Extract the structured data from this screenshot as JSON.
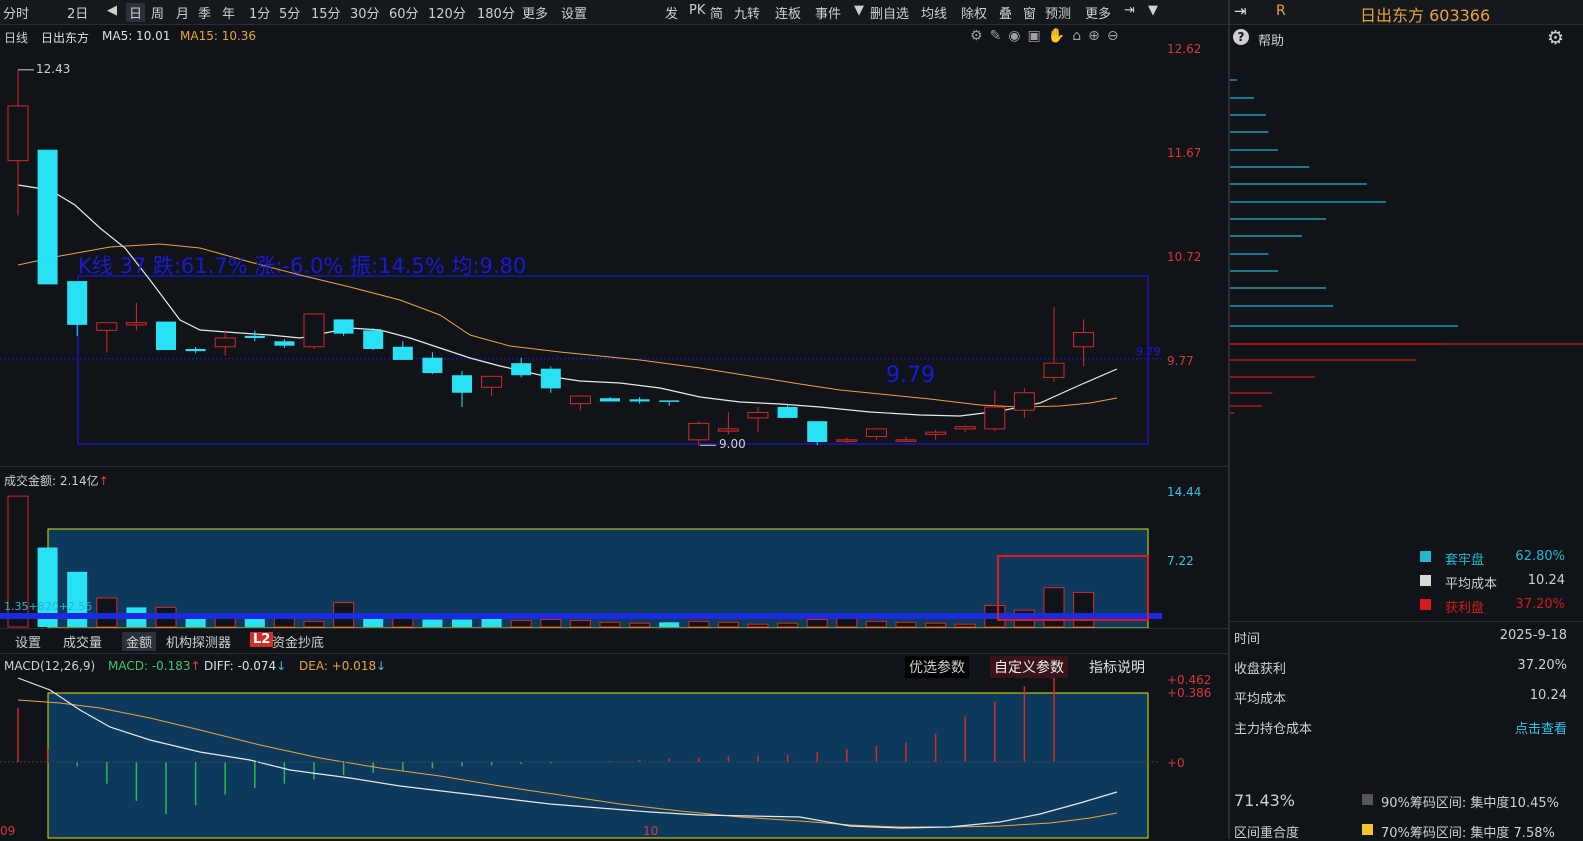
{
  "toolbar": {
    "left_items": [
      "分时",
      "2日",
      "日",
      "周",
      "月",
      "季",
      "年",
      "1分",
      "5分",
      "15分",
      "30分",
      "60分",
      "120分",
      "180分",
      "更多",
      "设置"
    ],
    "right_items": [
      "发",
      "PK",
      "简",
      "九转",
      "连板",
      "事件",
      "删自选",
      "均线",
      "除权",
      "叠",
      "窗",
      "预测",
      "更多"
    ]
  },
  "kline": {
    "period": "日线",
    "name": "日出东方",
    "ma5_label": "MA5: 10.01",
    "ma15_label": "MA15: 10.36",
    "summary": "K线 37 跌:61.7% 涨:-6.0% 振:14.5% 均:9.80",
    "high_label": "12.43",
    "low_label": "9.00",
    "avg_label": "9.79",
    "avg_tag": "9.79",
    "y_ticks": [
      "12.62",
      "11.67",
      "10.72",
      "9.77"
    ]
  },
  "volume": {
    "title": "成交金额: 2.14亿",
    "y_ticks": [
      "14.44",
      "7.22"
    ],
    "overlay_text": "1.35+820+2.55"
  },
  "tabs": [
    "设置",
    "成交量",
    "金额",
    "机构探测器",
    "L2",
    "资金抄底"
  ],
  "macd": {
    "params": "MACD(12,26,9)",
    "macd_label": "MACD: -0.183",
    "diff_label": "DIFF: -0.074",
    "dea_label": "DEA: +0.018",
    "buttons": [
      "优选参数",
      "自定义参数",
      "指标说明"
    ],
    "y_ticks": [
      "+0.462",
      "+0.386",
      "+0"
    ]
  },
  "x_labels": [
    "09",
    "10"
  ],
  "right_panel": {
    "r_label": "R",
    "stock": "日出东方 603366",
    "help": "帮助",
    "legend": [
      {
        "label": "套牢盘",
        "value": "62.80%",
        "color": "#23b7cc"
      },
      {
        "label": "平均成本",
        "value": "10.24",
        "color": "#d8d8d8"
      },
      {
        "label": "获利盘",
        "value": "37.20%",
        "color": "#d41a1a"
      }
    ],
    "stats": [
      {
        "label": "时间",
        "value": "2025-9-18"
      },
      {
        "label": "收盘获利",
        "value": "37.20%"
      },
      {
        "label": "平均成本",
        "value": "10.24"
      },
      {
        "label": "主力持仓成本",
        "value": "点击查看"
      }
    ],
    "concentration": "71.43%",
    "overlap_label": "区间重合度",
    "range90": "90%筹码区间: 集中度10.45%",
    "range70": "70%筹码区间: 集中度 7.58%",
    "chip_bars_cyan": [
      0.03,
      0.1,
      0.15,
      0.16,
      0.2,
      0.33,
      0.57,
      0.65,
      0.4,
      0.3,
      0.16,
      0.2,
      0.4,
      0.43,
      0.95
    ],
    "chip_bars_red": [
      1.0,
      0.88,
      0.4,
      0.2,
      0.15,
      0.02
    ]
  },
  "chart_data": {
    "type": "candlestick",
    "ohlc": [
      [
        11.6,
        12.43,
        11.1,
        12.1
      ],
      [
        11.7,
        11.7,
        11.1,
        10.47
      ],
      [
        10.5,
        10.5,
        10.0,
        10.1
      ],
      [
        10.05,
        10.1,
        9.85,
        10.12
      ],
      [
        10.1,
        10.3,
        10.05,
        10.12
      ],
      [
        10.13,
        10.13,
        9.9,
        9.87
      ],
      [
        9.88,
        9.9,
        9.84,
        9.86
      ],
      [
        9.9,
        10.05,
        9.82,
        9.98
      ],
      [
        10.0,
        10.05,
        9.95,
        9.98
      ],
      [
        9.95,
        9.97,
        9.89,
        9.91
      ],
      [
        9.9,
        10.18,
        9.88,
        10.2
      ],
      [
        10.15,
        10.15,
        10.0,
        10.02
      ],
      [
        10.05,
        10.07,
        9.87,
        9.88
      ],
      [
        9.9,
        9.95,
        9.78,
        9.78
      ],
      [
        9.8,
        9.85,
        9.65,
        9.66
      ],
      [
        9.64,
        9.68,
        9.35,
        9.48
      ],
      [
        9.53,
        9.63,
        9.45,
        9.63
      ],
      [
        9.75,
        9.8,
        9.62,
        9.64
      ],
      [
        9.7,
        9.72,
        9.48,
        9.52
      ],
      [
        9.38,
        9.45,
        9.32,
        9.45
      ],
      [
        9.43,
        9.44,
        9.4,
        9.4
      ],
      [
        9.42,
        9.44,
        9.38,
        9.4
      ],
      [
        9.41,
        9.41,
        9.36,
        9.4
      ],
      [
        9.05,
        9.22,
        9.0,
        9.2
      ],
      [
        9.13,
        9.3,
        9.1,
        9.15
      ],
      [
        9.25,
        9.35,
        9.12,
        9.3
      ],
      [
        9.35,
        9.38,
        9.25,
        9.25
      ],
      [
        9.22,
        9.22,
        9.0,
        9.03
      ],
      [
        9.05,
        9.07,
        9.02,
        9.05
      ],
      [
        9.08,
        9.13,
        9.05,
        9.15
      ],
      [
        9.05,
        9.08,
        9.05,
        9.05
      ],
      [
        9.1,
        9.14,
        9.05,
        9.12
      ],
      [
        9.15,
        9.18,
        9.12,
        9.17
      ],
      [
        9.15,
        9.5,
        9.13,
        9.35
      ],
      [
        9.32,
        9.52,
        9.25,
        9.48
      ],
      [
        9.62,
        10.26,
        9.58,
        9.75
      ],
      [
        9.9,
        10.15,
        9.72,
        10.03
      ]
    ],
    "ma5": [
      11.4,
      11.3,
      10.8,
      10.3,
      10.0,
      10.0,
      10.0,
      9.98,
      10.02,
      10.0,
      9.96,
      9.82,
      9.7,
      9.65,
      9.62,
      9.6,
      9.58,
      9.52,
      9.48,
      9.42,
      9.35,
      9.25,
      9.18,
      9.15,
      9.12,
      9.1,
      9.08,
      9.06,
      9.07,
      9.1,
      9.15,
      9.22,
      9.3,
      9.4,
      9.55
    ],
    "ma15": [
      10.6,
      10.78,
      10.8,
      10.78,
      10.7,
      10.5,
      10.2,
      10.08,
      9.98,
      9.9,
      9.8,
      9.75,
      9.72,
      9.66,
      9.6,
      9.5,
      9.45,
      9.4,
      9.36,
      9.32,
      9.28,
      9.24,
      9.2,
      9.18,
      9.17,
      9.17,
      9.2,
      9.27
    ],
    "volume": [
      14.0,
      8.5,
      5.9,
      3.1,
      2.1,
      2.1,
      1.0,
      1.1,
      1.1,
      1.0,
      0.6,
      2.6,
      0.9,
      1.0,
      0.8,
      0.8,
      1.1,
      0.7,
      0.8,
      0.7,
      0.5,
      0.4,
      0.5,
      0.6,
      0.5,
      0.3,
      0.4,
      0.8,
      0.9,
      0.6,
      0.5,
      0.4,
      0.3,
      2.3,
      1.8,
      4.2,
      3.7
    ],
    "volume_up": [
      true,
      false,
      false,
      true,
      false,
      true,
      false,
      true,
      false,
      true,
      true,
      true,
      false,
      true,
      false,
      false,
      false,
      true,
      true,
      true,
      true,
      true,
      false,
      true,
      true,
      true,
      true,
      true,
      true,
      true,
      true,
      true,
      true,
      true,
      true,
      true,
      true
    ],
    "macd_hist": [
      0.25,
      0.06,
      -0.02,
      -0.1,
      -0.18,
      -0.24,
      -0.2,
      -0.15,
      -0.12,
      -0.1,
      -0.08,
      -0.06,
      -0.05,
      -0.04,
      -0.03,
      -0.02,
      -0.015,
      -0.01,
      -0.005,
      0.0,
      0.005,
      0.01,
      0.015,
      0.02,
      0.025,
      0.03,
      0.035,
      0.045,
      0.06,
      0.075,
      0.09,
      0.13,
      0.21,
      0.28,
      0.35,
      0.42
    ],
    "macd_diff": [
      0.45,
      0.4,
      0.3,
      0.22,
      0.12,
      0.02,
      -0.05,
      -0.1,
      -0.13,
      -0.16,
      -0.18,
      -0.2,
      -0.21,
      -0.22,
      -0.23,
      -0.24,
      -0.245,
      -0.25,
      -0.25,
      -0.24,
      -0.23,
      -0.22,
      -0.21,
      -0.2,
      -0.18,
      -0.15,
      -0.1,
      -0.05,
      0.02
    ],
    "macd_dea": [
      0.36,
      0.35,
      0.32,
      0.27,
      0.21,
      0.16,
      0.11,
      0.07,
      0.03,
      -0.01,
      -0.05,
      -0.08,
      -0.11,
      -0.14,
      -0.16,
      -0.18,
      -0.2,
      -0.21,
      -0.22,
      -0.22,
      -0.22,
      -0.21,
      -0.2,
      -0.19,
      -0.17,
      -0.14
    ]
  }
}
